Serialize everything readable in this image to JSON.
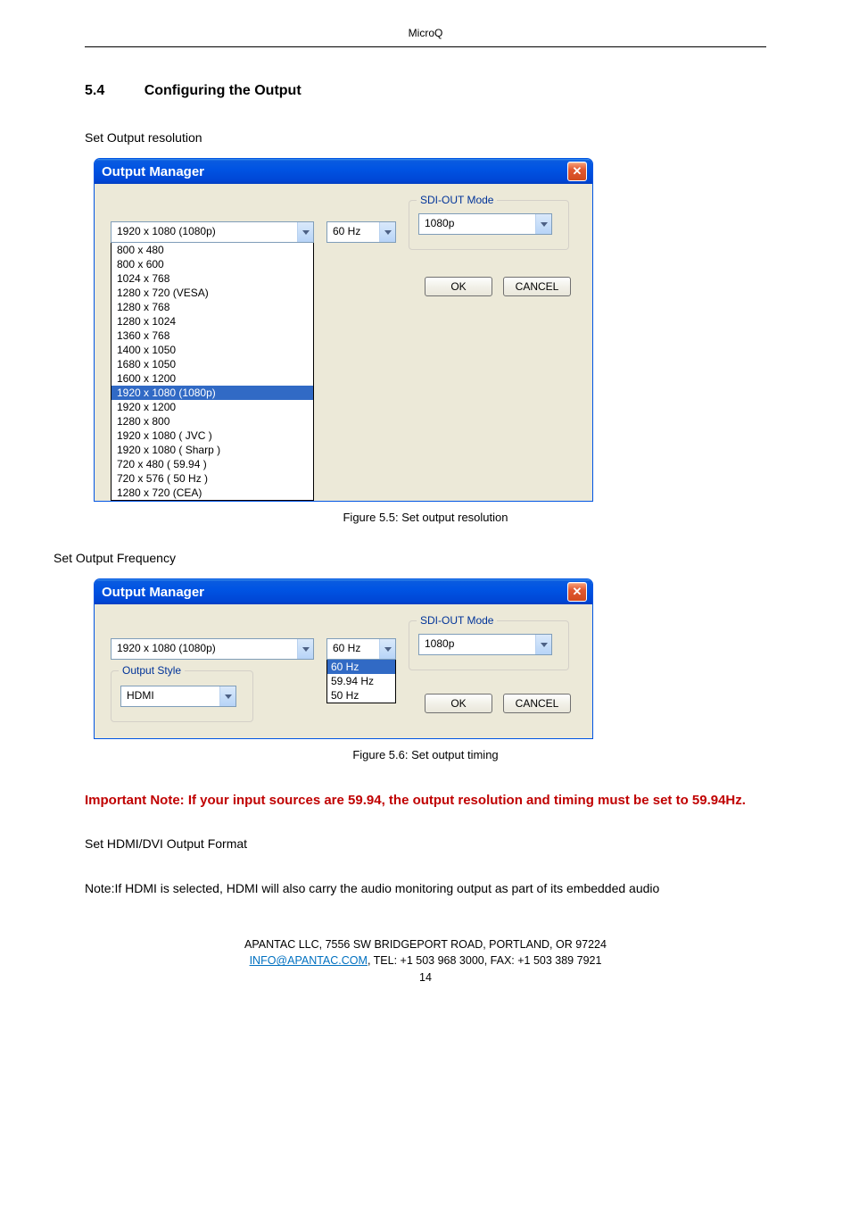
{
  "header": {
    "product": "MicroQ"
  },
  "section": {
    "number": "5.4",
    "title": "Configuring the Output"
  },
  "text": {
    "set_resolution": "Set Output resolution",
    "set_frequency": "Set Output Frequency",
    "important_note": "Important Note:    If your input sources are 59.94, the output resolution and timing must be set to 59.94Hz.",
    "set_hdmi": "Set HDMI/DVI Output Format",
    "note_hdmi": "Note:If HDMI is selected, HDMI will also carry the audio monitoring output as part of its embedded audio"
  },
  "dialog1": {
    "title": "Output Manager",
    "resolution_value": "1920 x 1080 (1080p)",
    "freq_value": "60 Hz",
    "sdi_label": "SDI-OUT Mode",
    "sdi_value": "1080p",
    "ok": "OK",
    "cancel": "CANCEL",
    "options": [
      "800 x 480",
      "800 x 600",
      "1024 x 768",
      "1280 x 720 (VESA)",
      "1280 x 768",
      "1280 x 1024",
      "1360 x 768",
      "1400 x 1050",
      "1680 x 1050",
      "1600 x 1200",
      "1920 x 1080 (1080p)",
      "1920 x 1200",
      "1280 x 800",
      "1920 x 1080 ( JVC )",
      "1920 x 1080 ( Sharp )",
      "720 x 480  ( 59.94 )",
      "720 x 576 ( 50 Hz )",
      "1280 x 720 (CEA)"
    ],
    "selected_index": 10
  },
  "caption1": "Figure 5.5:   Set output resolution",
  "dialog2": {
    "title": "Output Manager",
    "resolution_value": "1920 x 1080 (1080p)",
    "freq_value": "60 Hz",
    "sdi_label": "SDI-OUT Mode",
    "sdi_value": "1080p",
    "style_label": "Output Style",
    "style_value": "HDMI",
    "ok": "OK",
    "cancel": "CANCEL",
    "freq_options": [
      "60 Hz",
      "59.94 Hz",
      "50 Hz"
    ],
    "freq_selected_index": 0
  },
  "caption2": "Figure 5.6:   Set output timing",
  "footer": {
    "line1": "APANTAC LLC, 7556 SW BRIDGEPORT ROAD, PORTLAND, OR 97224",
    "email": "INFO@APANTAC.COM",
    "line2_rest": ", TEL:   +1 503 968 3000, FAX:   +1 503 389 7921",
    "page": "14"
  }
}
